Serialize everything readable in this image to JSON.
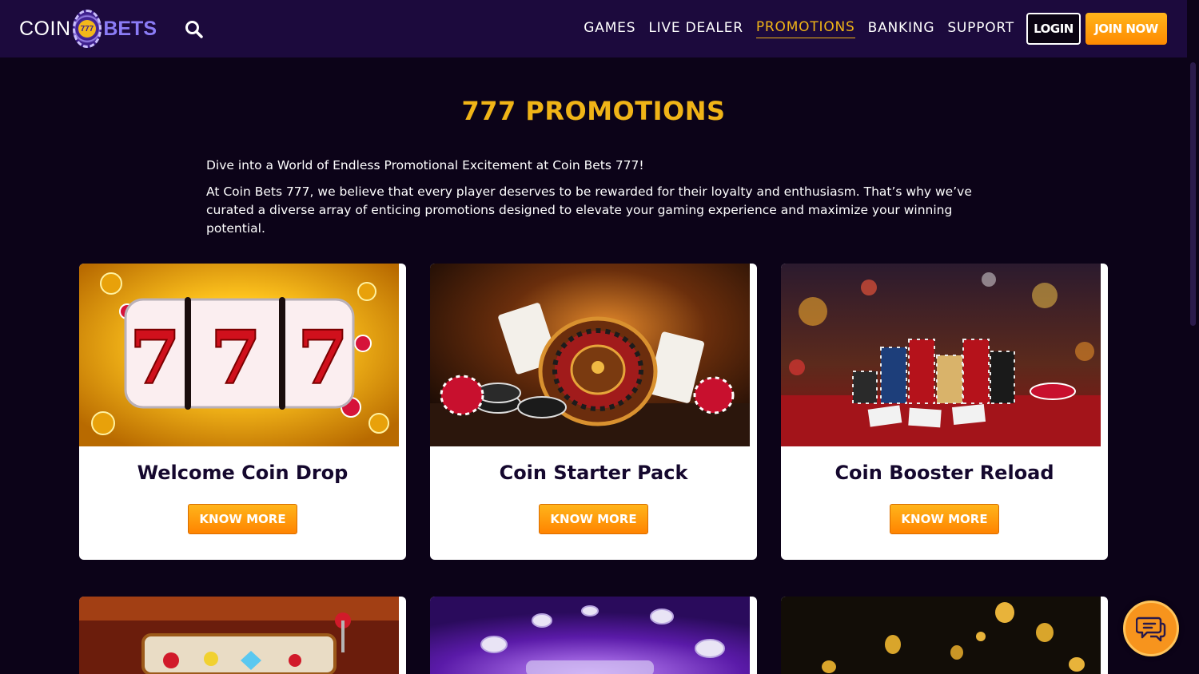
{
  "brand": {
    "logo_coin": "COIN",
    "logo_chip": "777",
    "logo_bets": "BETS"
  },
  "nav": {
    "items": [
      {
        "label": "GAMES",
        "active": false
      },
      {
        "label": "LIVE DEALER",
        "active": false
      },
      {
        "label": "PROMOTIONS",
        "active": true
      },
      {
        "label": "BANKING",
        "active": false
      },
      {
        "label": "SUPPORT",
        "active": false
      }
    ],
    "login_label": "LOGIN",
    "join_label": "JOIN NOW"
  },
  "page": {
    "title": "777 PROMOTIONS",
    "intro_lead": "Dive into a World of Endless Promotional Excitement at Coin Bets 777!",
    "intro_body": "At Coin Bets 777, we believe that every player deserves to be rewarded for their loyalty and enthusiasm. That’s why we’ve curated a diverse array of enticing promotions designed to elevate your gaming experience and maximize your winning potential."
  },
  "promotions": [
    {
      "title": "Welcome Coin Drop",
      "button": "KNOW MORE",
      "image": "slot-777-reels"
    },
    {
      "title": "Coin Starter Pack",
      "button": "KNOW MORE",
      "image": "roulette-wheel-cards"
    },
    {
      "title": "Coin Booster Reload",
      "button": "KNOW MORE",
      "image": "casino-chip-stacks"
    }
  ],
  "colors": {
    "header_bg": "#1c0a3d",
    "page_bg": "#0c0318",
    "accent": "#f0b417",
    "button_orange": "#ff8a00"
  },
  "icons": {
    "search": "search-icon",
    "chat": "chat-bubbles-icon"
  }
}
